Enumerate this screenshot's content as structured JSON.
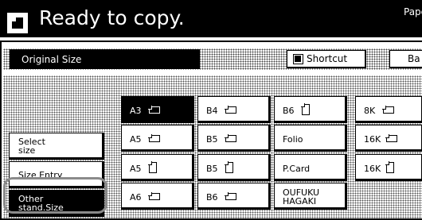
{
  "header": {
    "status": "Ready to copy.",
    "paper_partial": "Pape"
  },
  "toolbar": {
    "section_label": "Original Size",
    "shortcut_label": "Shortcut",
    "back_partial": "Ba"
  },
  "menu": {
    "select_size": [
      "Select",
      "size"
    ],
    "size_entry": "Size Entry",
    "other_size": [
      "Other",
      "stand.Size"
    ]
  },
  "sizes": [
    {
      "label": "A3",
      "orientation": "landscape",
      "selected": true
    },
    {
      "label": "B4",
      "orientation": "landscape",
      "selected": false
    },
    {
      "label": "B6",
      "orientation": "portrait",
      "selected": false
    },
    {
      "label": "8K",
      "orientation": "landscape",
      "selected": false
    },
    {
      "label": "A5",
      "orientation": "landscape",
      "selected": false
    },
    {
      "label": "B5",
      "orientation": "landscape",
      "selected": false
    },
    {
      "label": "Folio",
      "orientation": "none",
      "selected": false
    },
    {
      "label": "16K",
      "orientation": "landscape",
      "selected": false
    },
    {
      "label": "A5",
      "orientation": "portrait",
      "selected": false
    },
    {
      "label": "B5",
      "orientation": "portrait",
      "selected": false
    },
    {
      "label": "P.Card",
      "orientation": "none",
      "selected": false
    },
    {
      "label": "16K",
      "orientation": "portrait",
      "selected": false
    },
    {
      "label": "A6",
      "orientation": "landscape",
      "selected": false
    },
    {
      "label": "B6",
      "orientation": "landscape",
      "selected": false
    },
    {
      "label": "OUFUKU HAGAKI",
      "line1": "OUFUKU",
      "line2": "HAGAKI",
      "orientation": "none",
      "selected": false
    }
  ],
  "colors": {
    "background": "#000000",
    "highlight": "#8a8a8a"
  }
}
